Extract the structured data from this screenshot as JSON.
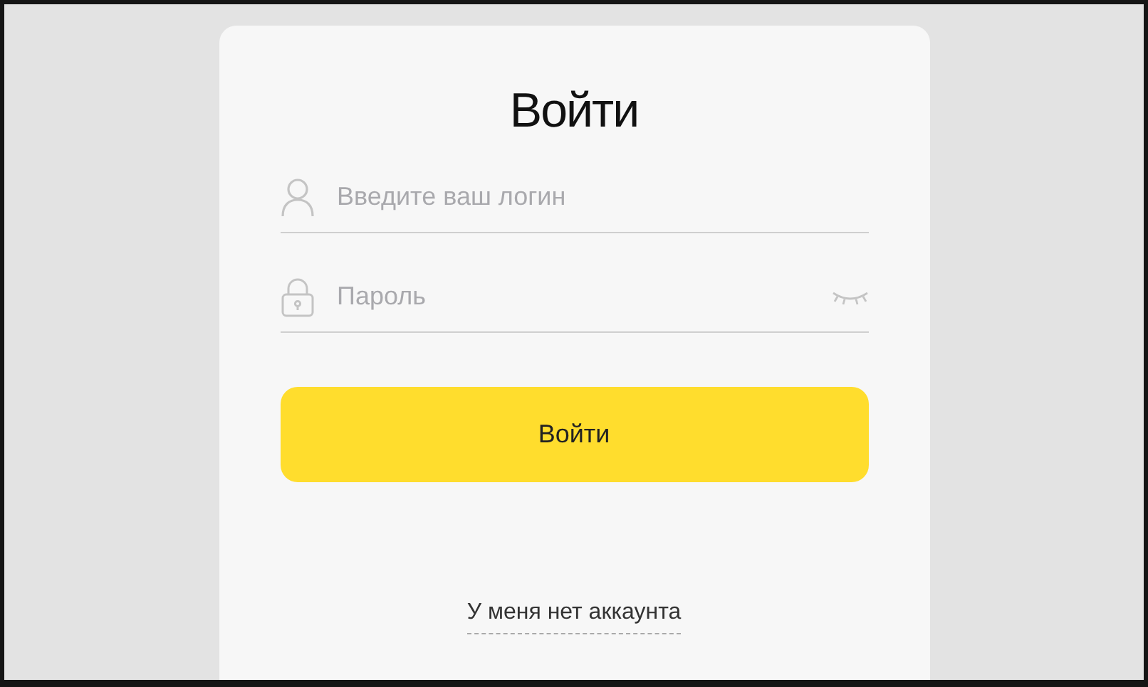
{
  "title": "Войти",
  "fields": [
    {
      "kind": "login",
      "placeholder": "Введите ваш логин"
    },
    {
      "kind": "password",
      "placeholder": "Пароль"
    }
  ],
  "submit_button": "Войти",
  "no_account_link": "У меня нет аккаунта"
}
